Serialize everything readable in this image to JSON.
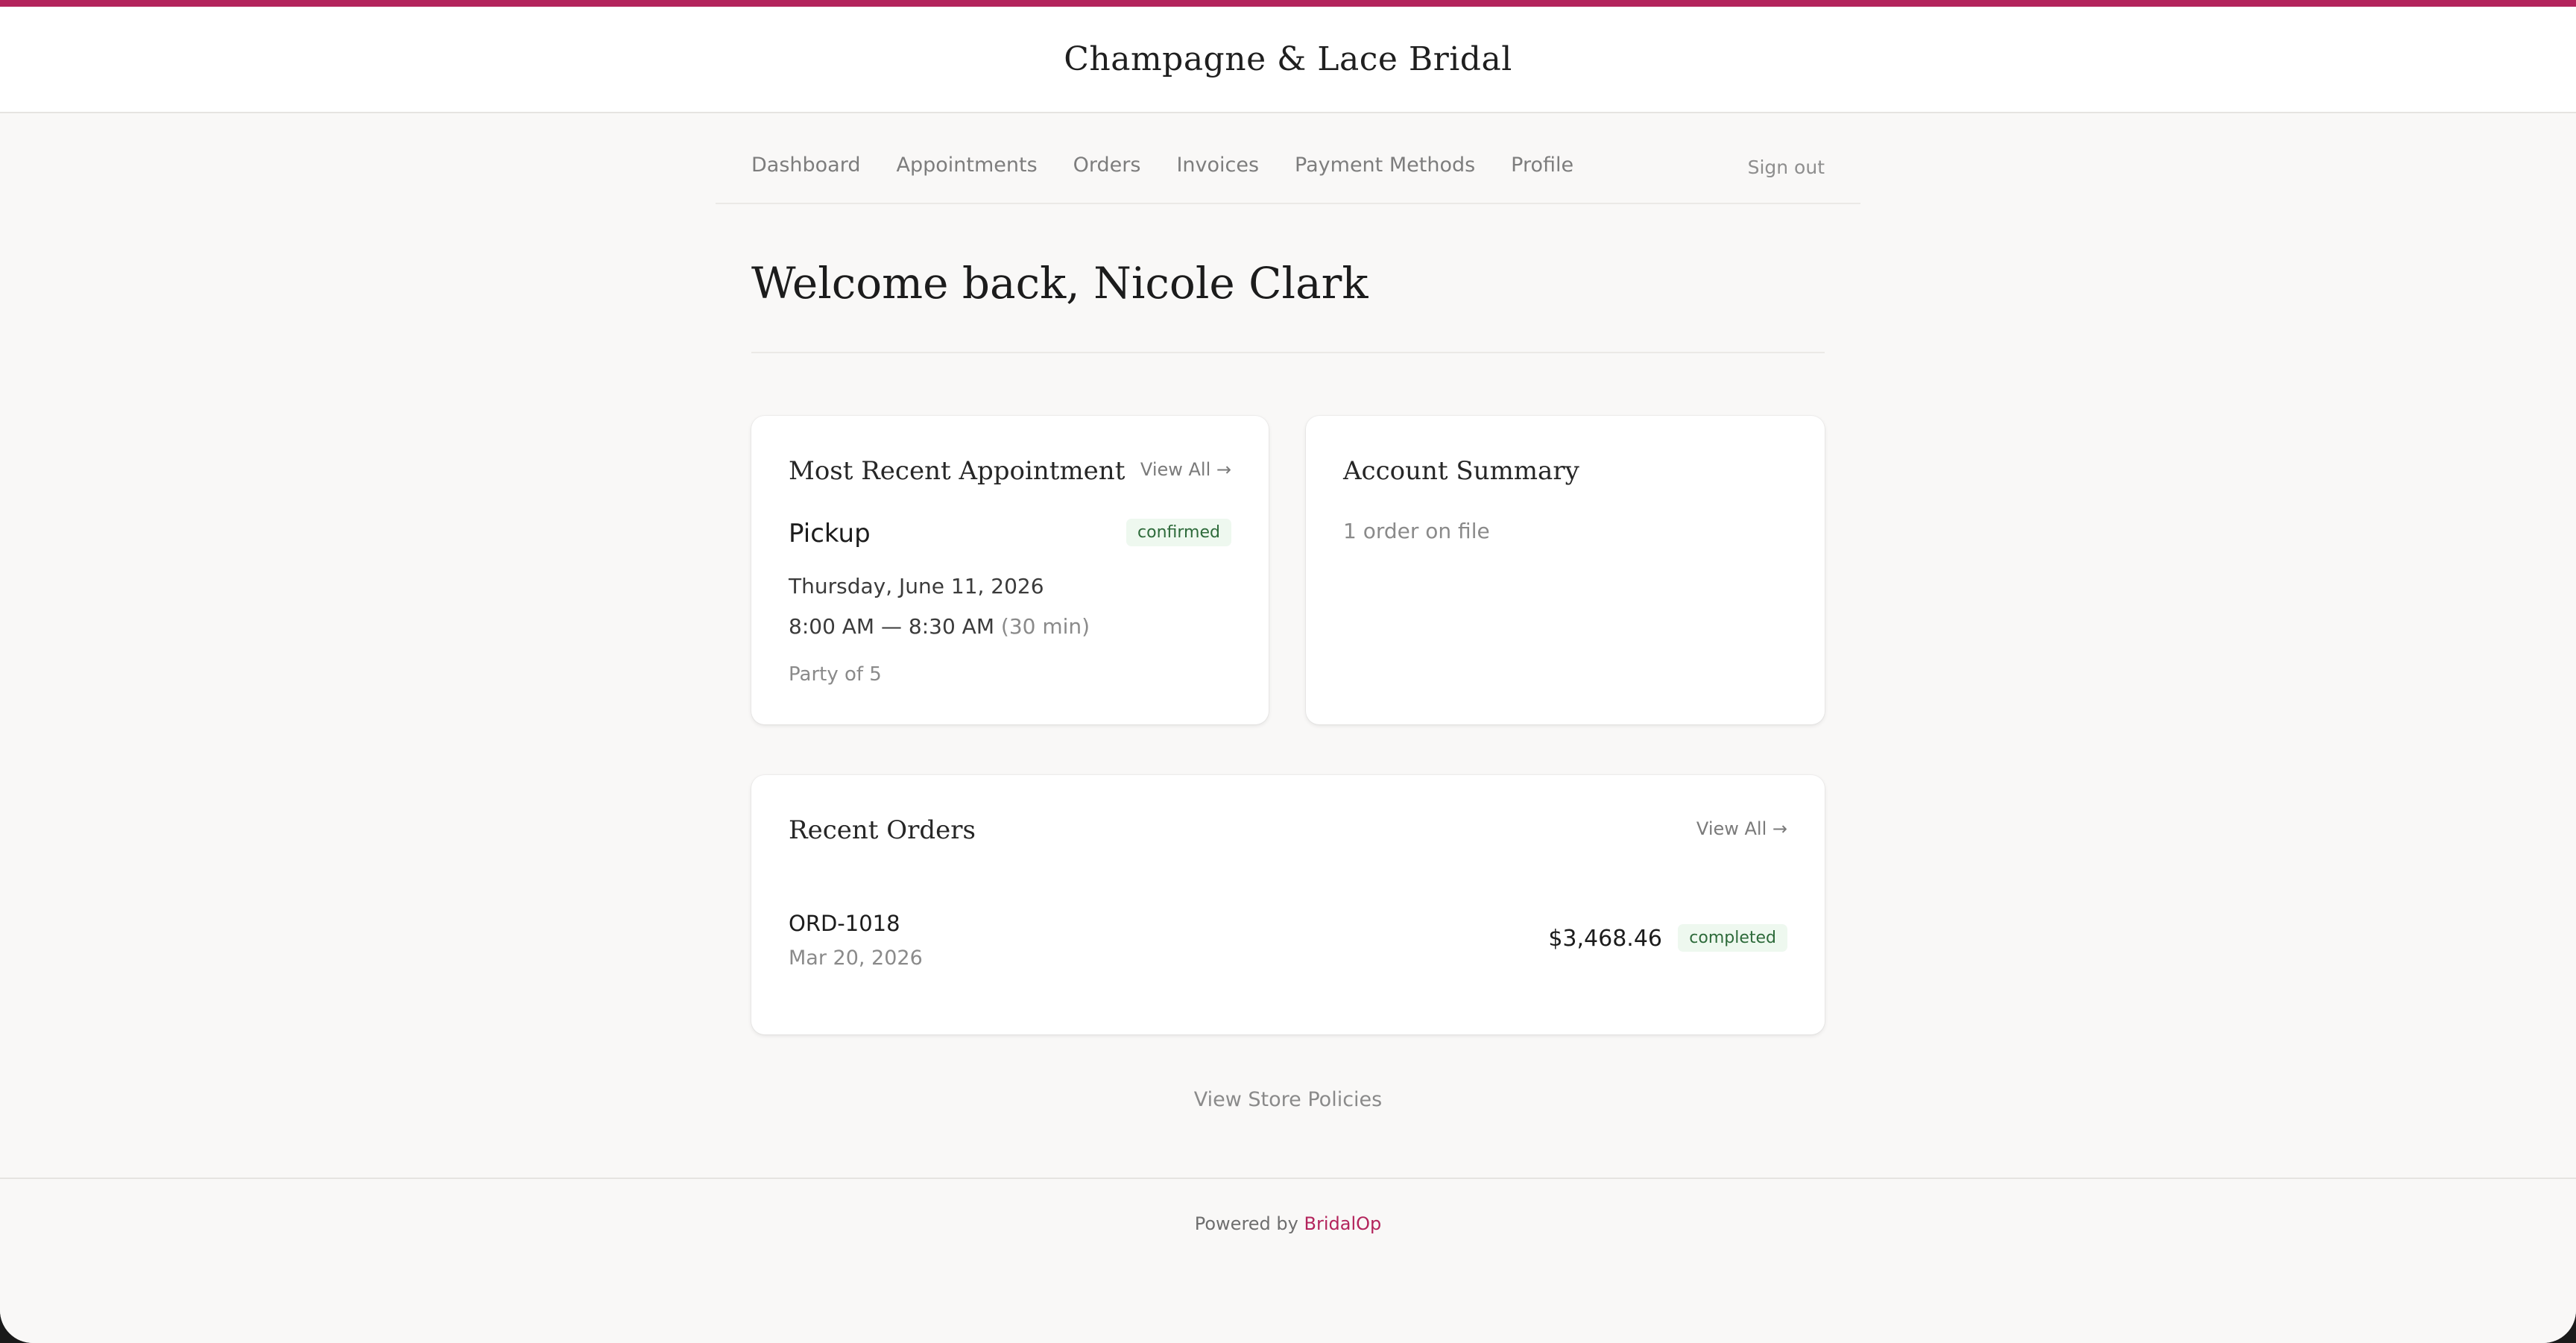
{
  "brand": {
    "name": "Champagne & Lace Bridal",
    "accent_color": "#b3245c"
  },
  "nav": {
    "items": [
      {
        "label": "Dashboard"
      },
      {
        "label": "Appointments"
      },
      {
        "label": "Orders"
      },
      {
        "label": "Invoices"
      },
      {
        "label": "Payment Methods"
      },
      {
        "label": "Profile"
      }
    ],
    "sign_out": "Sign out"
  },
  "welcome": {
    "title": "Welcome back, Nicole Clark"
  },
  "appointment_card": {
    "title": "Most Recent Appointment",
    "view_all": "View All →",
    "type": "Pickup",
    "status": "confirmed",
    "date": "Thursday, June 11, 2026",
    "time": "8:00 AM — 8:30 AM",
    "duration": "(30 min)",
    "party": "Party of 5"
  },
  "account_summary": {
    "title": "Account Summary",
    "text": "1 order on file"
  },
  "recent_orders": {
    "title": "Recent Orders",
    "view_all": "View All →",
    "orders": [
      {
        "id": "ORD-1018",
        "date": "Mar 20, 2026",
        "amount": "$3,468.46",
        "status": "completed"
      }
    ]
  },
  "policies_link": "View Store Policies",
  "footer": {
    "prefix": "Powered by",
    "link": "BridalOp"
  },
  "colors": {
    "status_badge_bg": "#eef8ef",
    "status_badge_text": "#2d6a3a"
  }
}
